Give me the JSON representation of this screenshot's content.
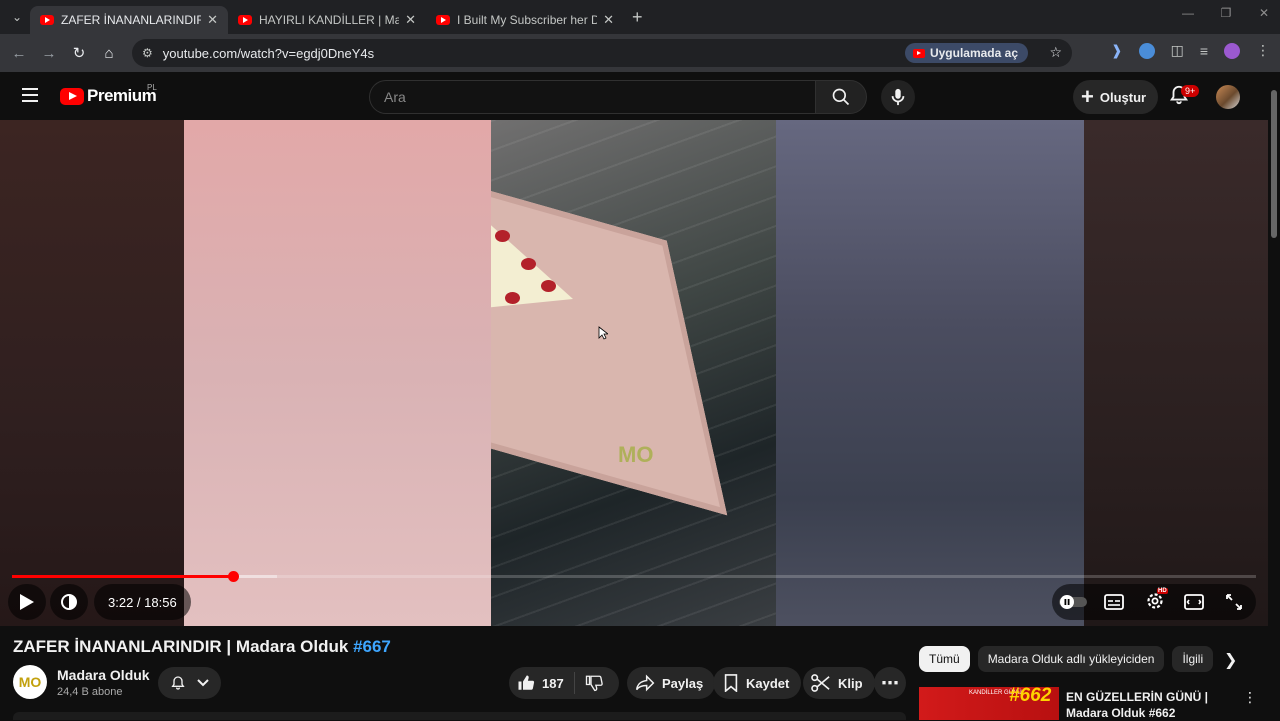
{
  "browser": {
    "tabs": [
      {
        "label": "ZAFER İNANANLARINDIR | Mad"
      },
      {
        "label": "HAYIRLI KANDİLLER | Madara O"
      },
      {
        "label": "I Built My Subscriber her Dream"
      }
    ],
    "new_tab": "+",
    "url": "youtube.com/watch?v=egdj0DneY4s",
    "open_in_app": "Uygulamada aç"
  },
  "masthead": {
    "logo_text": "Premium",
    "country_code": "PL",
    "search_placeholder": "Ara",
    "create_label": "Oluştur",
    "notifications_badge": "9+"
  },
  "player": {
    "watermark": "MO",
    "time": "3:22 / 18:56",
    "progress_played_fraction": 0.178,
    "progress_buffered_fraction": 0.213,
    "hd_badge": "HD"
  },
  "video": {
    "title": "ZAFER İNANANLARINDIR | Madara Olduk",
    "title_tag": "#667",
    "channel_initials": "MO",
    "channel_name": "Madara Olduk",
    "subscribers": "24,4 B abone",
    "likes": "187",
    "share": "Paylaş",
    "save": "Kaydet",
    "clip": "Klip"
  },
  "sidebar": {
    "chips": [
      "Tümü",
      "Madara Olduk adlı yükleyiciden",
      "İlgili"
    ],
    "recommended": [
      {
        "thumb_small_text": "KANDİLLER GÜNÜ",
        "thumb_number": "#662",
        "title": "EN GÜZELLERİN GÜNÜ | Madara Olduk #662"
      }
    ]
  },
  "colors": {
    "accent": "#ff0000",
    "link": "#3ea6ff",
    "background": "#0f0f0f"
  }
}
